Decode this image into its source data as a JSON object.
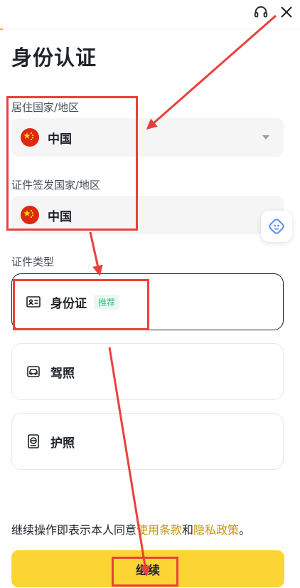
{
  "header": {
    "support_icon": "headset-icon",
    "close_icon": "close-icon"
  },
  "page_title": "身份认证",
  "residence": {
    "label": "居住国家/地区",
    "value": "中国",
    "flag_icon": "china-flag-icon"
  },
  "issuing": {
    "label": "证件签发国家/地区",
    "value": "中国",
    "flag_icon": "china-flag-icon"
  },
  "doc_type": {
    "label": "证件类型",
    "options": [
      {
        "label": "身份证",
        "badge": "推荐",
        "icon": "id-card-icon",
        "selected": true
      },
      {
        "label": "驾照",
        "icon": "driver-license-icon",
        "selected": false
      },
      {
        "label": "护照",
        "icon": "passport-icon",
        "selected": false
      }
    ]
  },
  "terms": {
    "prefix": "继续操作即表示本人同意",
    "terms_link": "使用条款",
    "and": "和",
    "privacy_link": "隐私政策",
    "suffix": "。"
  },
  "continue_label": "继续",
  "colors": {
    "accent": "#fcd535",
    "link": "#c99400",
    "badge": "#2ebd85",
    "annotation": "#e8413d"
  }
}
